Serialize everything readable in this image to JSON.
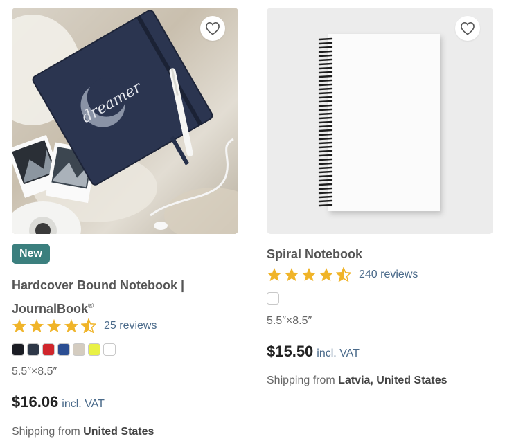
{
  "products": [
    {
      "badge": "New",
      "title": "Hardcover Bound Notebook | JournalBook",
      "title_mark": "®",
      "cover_text": "dreamer",
      "stars": 4.5,
      "reviews": "25 reviews",
      "swatches": [
        "#1b1d24",
        "#2e3848",
        "#d0262c",
        "#2b4e93",
        "#d4ccc0",
        "#e9f145",
        "#ffffff"
      ],
      "size": "5.5″×8.5″",
      "price": "$16.06",
      "vat": "incl. VAT",
      "ship_prefix": "Shipping from",
      "ship_from": "United States"
    },
    {
      "title": "Spiral Notebook",
      "stars": 4.5,
      "reviews": "240 reviews",
      "size": "5.5″×8.5″",
      "price": "$15.50",
      "vat": "incl. VAT",
      "ship_prefix": "Shipping from",
      "ship_from": "Latvia, United States"
    }
  ],
  "icons": {
    "favorite": "heart-outline-icon",
    "star": "star-icon"
  },
  "colors": {
    "badge": "#3b7f7e",
    "star": "#f0b429",
    "link": "#4a6a8a"
  }
}
